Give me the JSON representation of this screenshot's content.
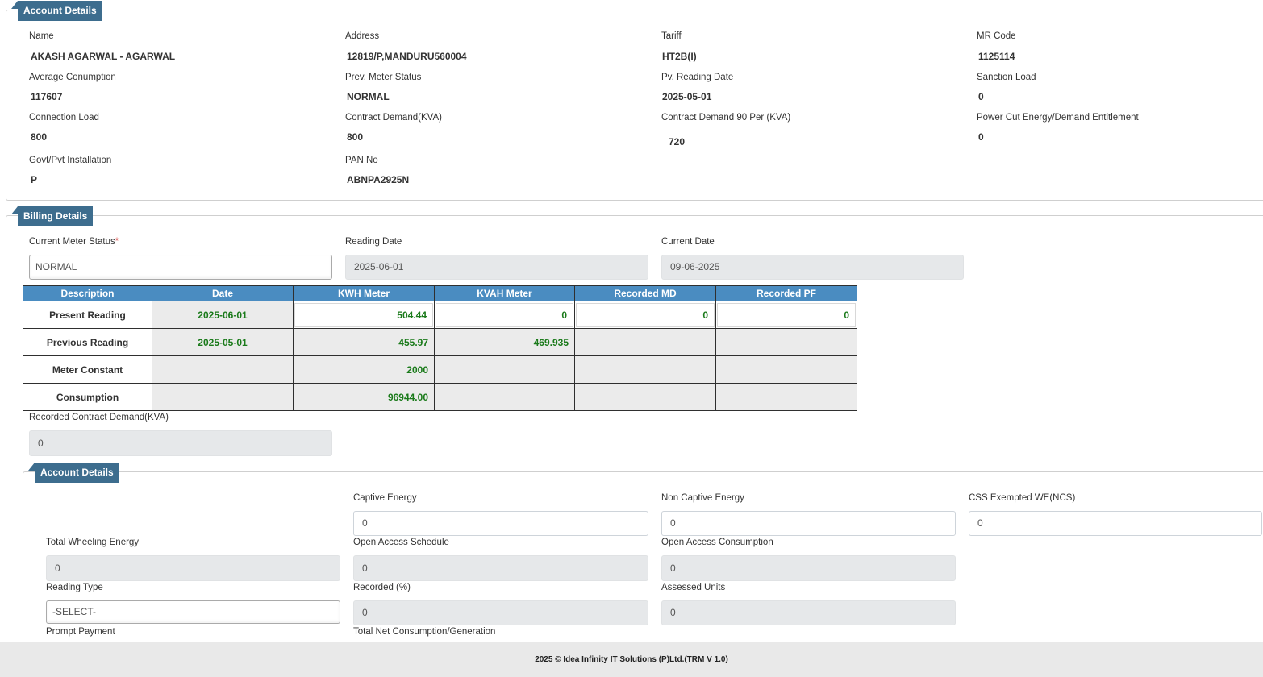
{
  "account": {
    "legend": "Account Details",
    "name_label": "Name",
    "name_value": "AKASH AGARWAL - AGARWAL",
    "address_label": "Address",
    "address_value": "12819/P,MANDURU560004",
    "tariff_label": "Tariff",
    "tariff_value": "HT2B(I)",
    "mrcode_label": "MR Code",
    "mrcode_value": "1125114",
    "avgcons_label": "Average Conumption",
    "avgcons_value": "117607",
    "prevstatus_label": "Prev. Meter Status",
    "prevstatus_value": "NORMAL",
    "pvdate_label": "Pv. Reading Date",
    "pvdate_value": "2025-05-01",
    "sanction_label": "Sanction Load",
    "sanction_value": "0",
    "connload_label": "Connection Load",
    "connload_value": "800",
    "contract_label": "Contract Demand(KVA)",
    "contract_value": "800",
    "contract90_label": "Contract Demand 90 Per (KVA)",
    "contract90_value": "720",
    "powercut_label": "Power Cut Energy/Demand Entitlement",
    "powercut_value": "0",
    "govt_label": "Govt/Pvt Installation",
    "govt_value": "P",
    "pan_label": "PAN No",
    "pan_value": "ABNPA2925N"
  },
  "billing": {
    "legend": "Billing Details",
    "curstatus_label": "Current Meter Status",
    "curstatus_required": "*",
    "curstatus_value": "NORMAL",
    "readdate_label": "Reading Date",
    "readdate_value": "2025-06-01",
    "curdate_label": "Current Date",
    "curdate_value": "09-06-2025",
    "table": {
      "headers": [
        "Description",
        "Date",
        "KWH Meter",
        "KVAH Meter",
        "Recorded MD",
        "Recorded PF"
      ],
      "rows": [
        {
          "desc": "Present Reading",
          "date": "2025-06-01",
          "kwh": "504.44",
          "kvah": "0",
          "md": "0",
          "pf": "0"
        },
        {
          "desc": "Previous Reading",
          "date": "2025-05-01",
          "kwh": "455.97",
          "kvah": "469.935",
          "md": "",
          "pf": ""
        },
        {
          "desc": "Meter Constant",
          "date": "",
          "kwh": "2000",
          "kvah": "",
          "md": "",
          "pf": ""
        },
        {
          "desc": "Consumption",
          "date": "",
          "kwh": "96944.00",
          "kvah": "",
          "md": "",
          "pf": ""
        }
      ]
    },
    "rcd_label": "Recorded Contract Demand(KVA)",
    "rcd_value": "0"
  },
  "account2": {
    "legend": "Account Details",
    "captive_label": "Captive Energy",
    "captive_value": "0",
    "noncaptive_label": "Non Captive Energy",
    "noncaptive_value": "0",
    "css_label": "CSS Exempted WE(NCS)",
    "css_value": "0",
    "wheeling_label": "Total Wheeling Energy",
    "wheeling_value": "0",
    "oasched_label": "Open Access Schedule",
    "oasched_value": "0",
    "oacons_label": "Open Access Consumption",
    "oacons_value": "0",
    "readtype_label": "Reading Type",
    "readtype_value": "-SELECT-",
    "recorded_label": "Recorded (%)",
    "recorded_value": "0",
    "assessed_label": "Assessed Units",
    "assessed_value": "0",
    "prompt_label": "Prompt Payment",
    "totalnet_label": "Total Net Consumption/Generation"
  },
  "footer": {
    "text": "2025 © Idea Infinity IT Solutions (P)Ltd.(TRM V 1.0)"
  }
}
